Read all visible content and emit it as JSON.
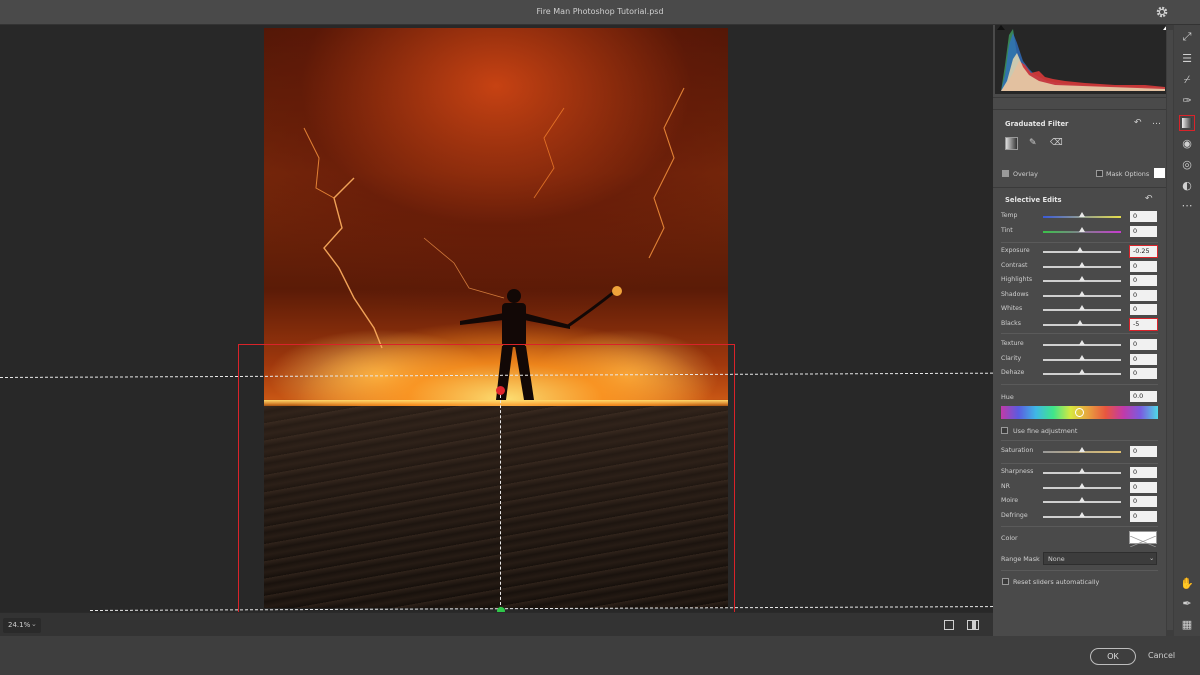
{
  "window": {
    "title": "Fire Man Photoshop Tutorial.psd"
  },
  "canvas": {
    "zoom": "24.1%"
  },
  "panel": {
    "graduated_filter": {
      "title": "Graduated Filter",
      "overlay_label": "Overlay",
      "overlay_checked": true,
      "mask_options_label": "Mask Options"
    },
    "selective_edits": {
      "title": "Selective Edits",
      "group1": [
        {
          "label": "Temp",
          "value": "0",
          "pos": 0.5
        },
        {
          "label": "Tint",
          "value": "0",
          "pos": 0.5
        }
      ],
      "group2": [
        {
          "label": "Exposure",
          "value": "-0.25",
          "pos": 0.47,
          "highlight": true
        },
        {
          "label": "Contrast",
          "value": "0",
          "pos": 0.5
        },
        {
          "label": "Highlights",
          "value": "0",
          "pos": 0.5
        },
        {
          "label": "Shadows",
          "value": "0",
          "pos": 0.5
        },
        {
          "label": "Whites",
          "value": "0",
          "pos": 0.5
        },
        {
          "label": "Blacks",
          "value": "-5",
          "pos": 0.48,
          "highlight": true
        }
      ],
      "group3": [
        {
          "label": "Texture",
          "value": "0",
          "pos": 0.5
        },
        {
          "label": "Clarity",
          "value": "0",
          "pos": 0.5
        },
        {
          "label": "Dehaze",
          "value": "0",
          "pos": 0.5
        }
      ],
      "hue": {
        "label": "Hue",
        "value": "0.0",
        "fine_adjust_label": "Use fine adjustment"
      },
      "group4": [
        {
          "label": "Saturation",
          "value": "0",
          "pos": 0.5
        }
      ],
      "group5": [
        {
          "label": "Sharpness",
          "value": "0",
          "pos": 0.5
        },
        {
          "label": "NR",
          "value": "0",
          "pos": 0.5
        },
        {
          "label": "Moire",
          "value": "0",
          "pos": 0.5
        },
        {
          "label": "Defringe",
          "value": "0",
          "pos": 0.5
        }
      ],
      "color_label": "Color",
      "range_mask_label": "Range Mask",
      "range_mask_value": "None",
      "reset_label": "Reset sliders automatically"
    }
  },
  "footer": {
    "ok_label": "OK",
    "cancel_label": "Cancel"
  },
  "colors": {
    "accent_red": "#d9232a",
    "pin_green": "#2fc84a"
  }
}
